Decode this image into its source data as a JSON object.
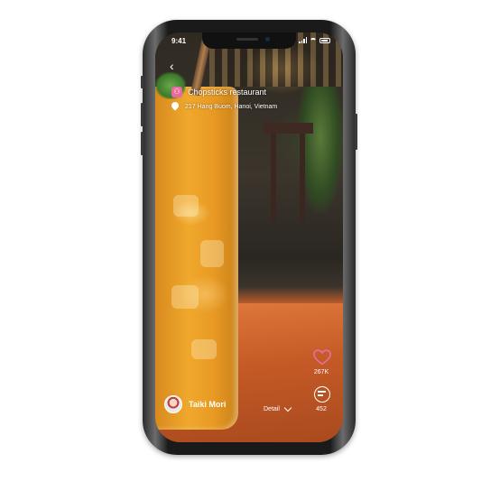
{
  "status_bar": {
    "time": "9:41"
  },
  "place": {
    "badge_icon": "restaurant-icon",
    "name": "Chopsticks restaurant",
    "address": "217 Hang Buom, Hanoi, Vietnam"
  },
  "actions": {
    "likes": "267K",
    "comments": "452"
  },
  "user": {
    "name": "Taiki Mori"
  },
  "detail": {
    "label": "Detail"
  },
  "colors": {
    "badge": "#e86aa0",
    "heart": "#e86aa0"
  }
}
